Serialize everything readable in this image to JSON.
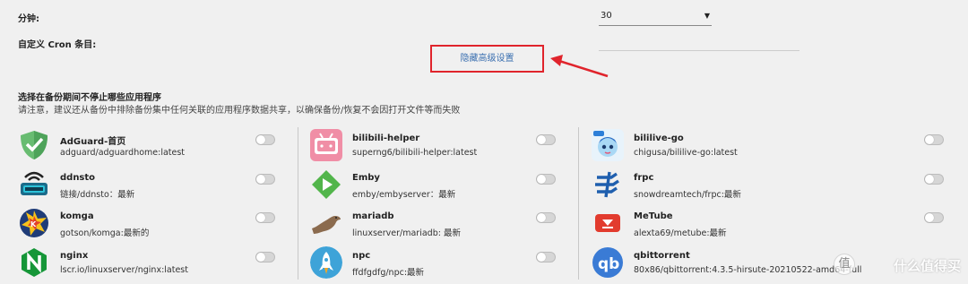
{
  "schedule": {
    "minutes_label": "分钟:",
    "minutes_value": "30",
    "cron_label": "自定义 Cron 条目:",
    "advanced_toggle_label": "隐藏高级设置"
  },
  "apps_section": {
    "title": "选择在备份期间不停止哪些应用程序",
    "description": "请注意，建议还从备份中排除备份集中任何关联的应用程序数据共享，以确保备份/恢复不会因打开文件等而失败",
    "columns": [
      [
        {
          "name": "AdGuard-首页",
          "image": "adguard/adguardhome:latest",
          "icon": "adguard-shield-icon",
          "enabled": false
        },
        {
          "name": "ddnsto",
          "image": "链接/ddnsto：最新",
          "icon": "ddnsto-router-icon",
          "enabled": false
        },
        {
          "name": "komga",
          "image": "gotson/komga:最新的",
          "icon": "komga-icon",
          "enabled": false
        },
        {
          "name": "nginx",
          "image": "lscr.io/linuxserver/nginx:latest",
          "icon": "nginx-icon",
          "enabled": false
        }
      ],
      [
        {
          "name": "bilibili-helper",
          "image": "superng6/bilibili-helper:latest",
          "icon": "bilibili-tv-icon",
          "enabled": false
        },
        {
          "name": "Emby",
          "image": "emby/embyserver：最新",
          "icon": "emby-play-icon",
          "enabled": false
        },
        {
          "name": "mariadb",
          "image": "linuxserver/mariadb: 最新",
          "icon": "mariadb-seal-icon",
          "enabled": false
        },
        {
          "name": "npc",
          "image": "ffdfgdfg/npc:最新",
          "icon": "npc-rocket-icon",
          "enabled": false
        }
      ],
      [
        {
          "name": "bililive-go",
          "image": "chigusa/bililive-go:latest",
          "icon": "bililive-avatar-icon",
          "enabled": false
        },
        {
          "name": "frpc",
          "image": "snowdreamtech/frpc:最新",
          "icon": "frpc-icon",
          "enabled": false
        },
        {
          "name": "MeTube",
          "image": "alexta69/metube:最新",
          "icon": "metube-download-icon",
          "enabled": false
        },
        {
          "name": "qbittorrent",
          "image": "80x86/qbittorrent:4.3.5-hirsute-20210522-amd64-full",
          "icon": "qbittorrent-icon",
          "enabled": false
        }
      ]
    ]
  },
  "watermark": {
    "text": "什么值得买",
    "glyph": "值"
  },
  "colors": {
    "annotation_red": "#e0242c",
    "link_blue": "#3a6fb0"
  }
}
